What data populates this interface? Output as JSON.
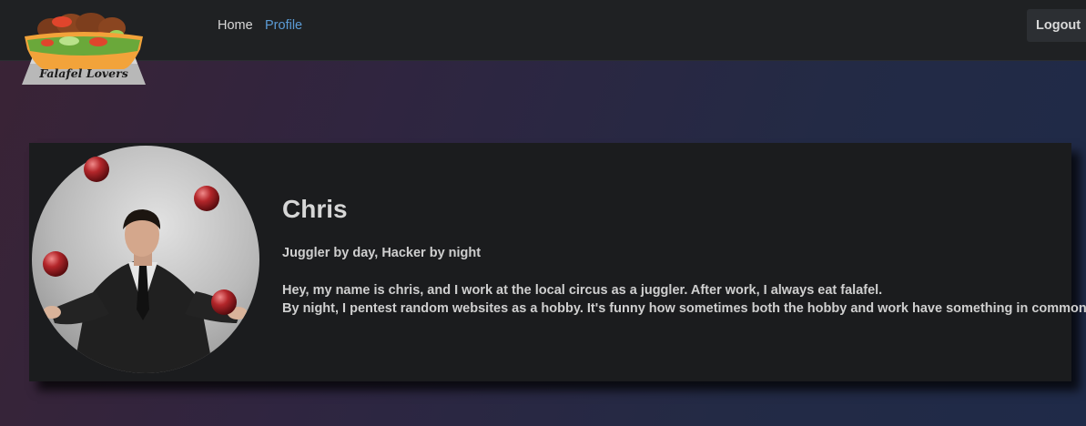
{
  "header": {
    "logo_text": "Falafel Lovers",
    "nav": [
      {
        "label": "Home"
      },
      {
        "label": "Profile"
      }
    ],
    "logout_label": "Logout"
  },
  "profile": {
    "name": "Chris",
    "tagline": "Juggler by day, Hacker by night",
    "bio_lines": [
      "Hey, my name is chris, and I work at the local circus as a juggler. After work, I always eat falafel.",
      "By night, I pentest random websites as a hobby. It's funny how sometimes both the hobby and work have something in common.."
    ]
  },
  "colors": {
    "navbar": "#1f2123",
    "card": "#1b1c1e",
    "link_active": "#5b9bd5",
    "text": "#cfcfcf"
  },
  "icons": {
    "logo": "falafel-bowl-logo",
    "avatar": "juggler-photo"
  }
}
